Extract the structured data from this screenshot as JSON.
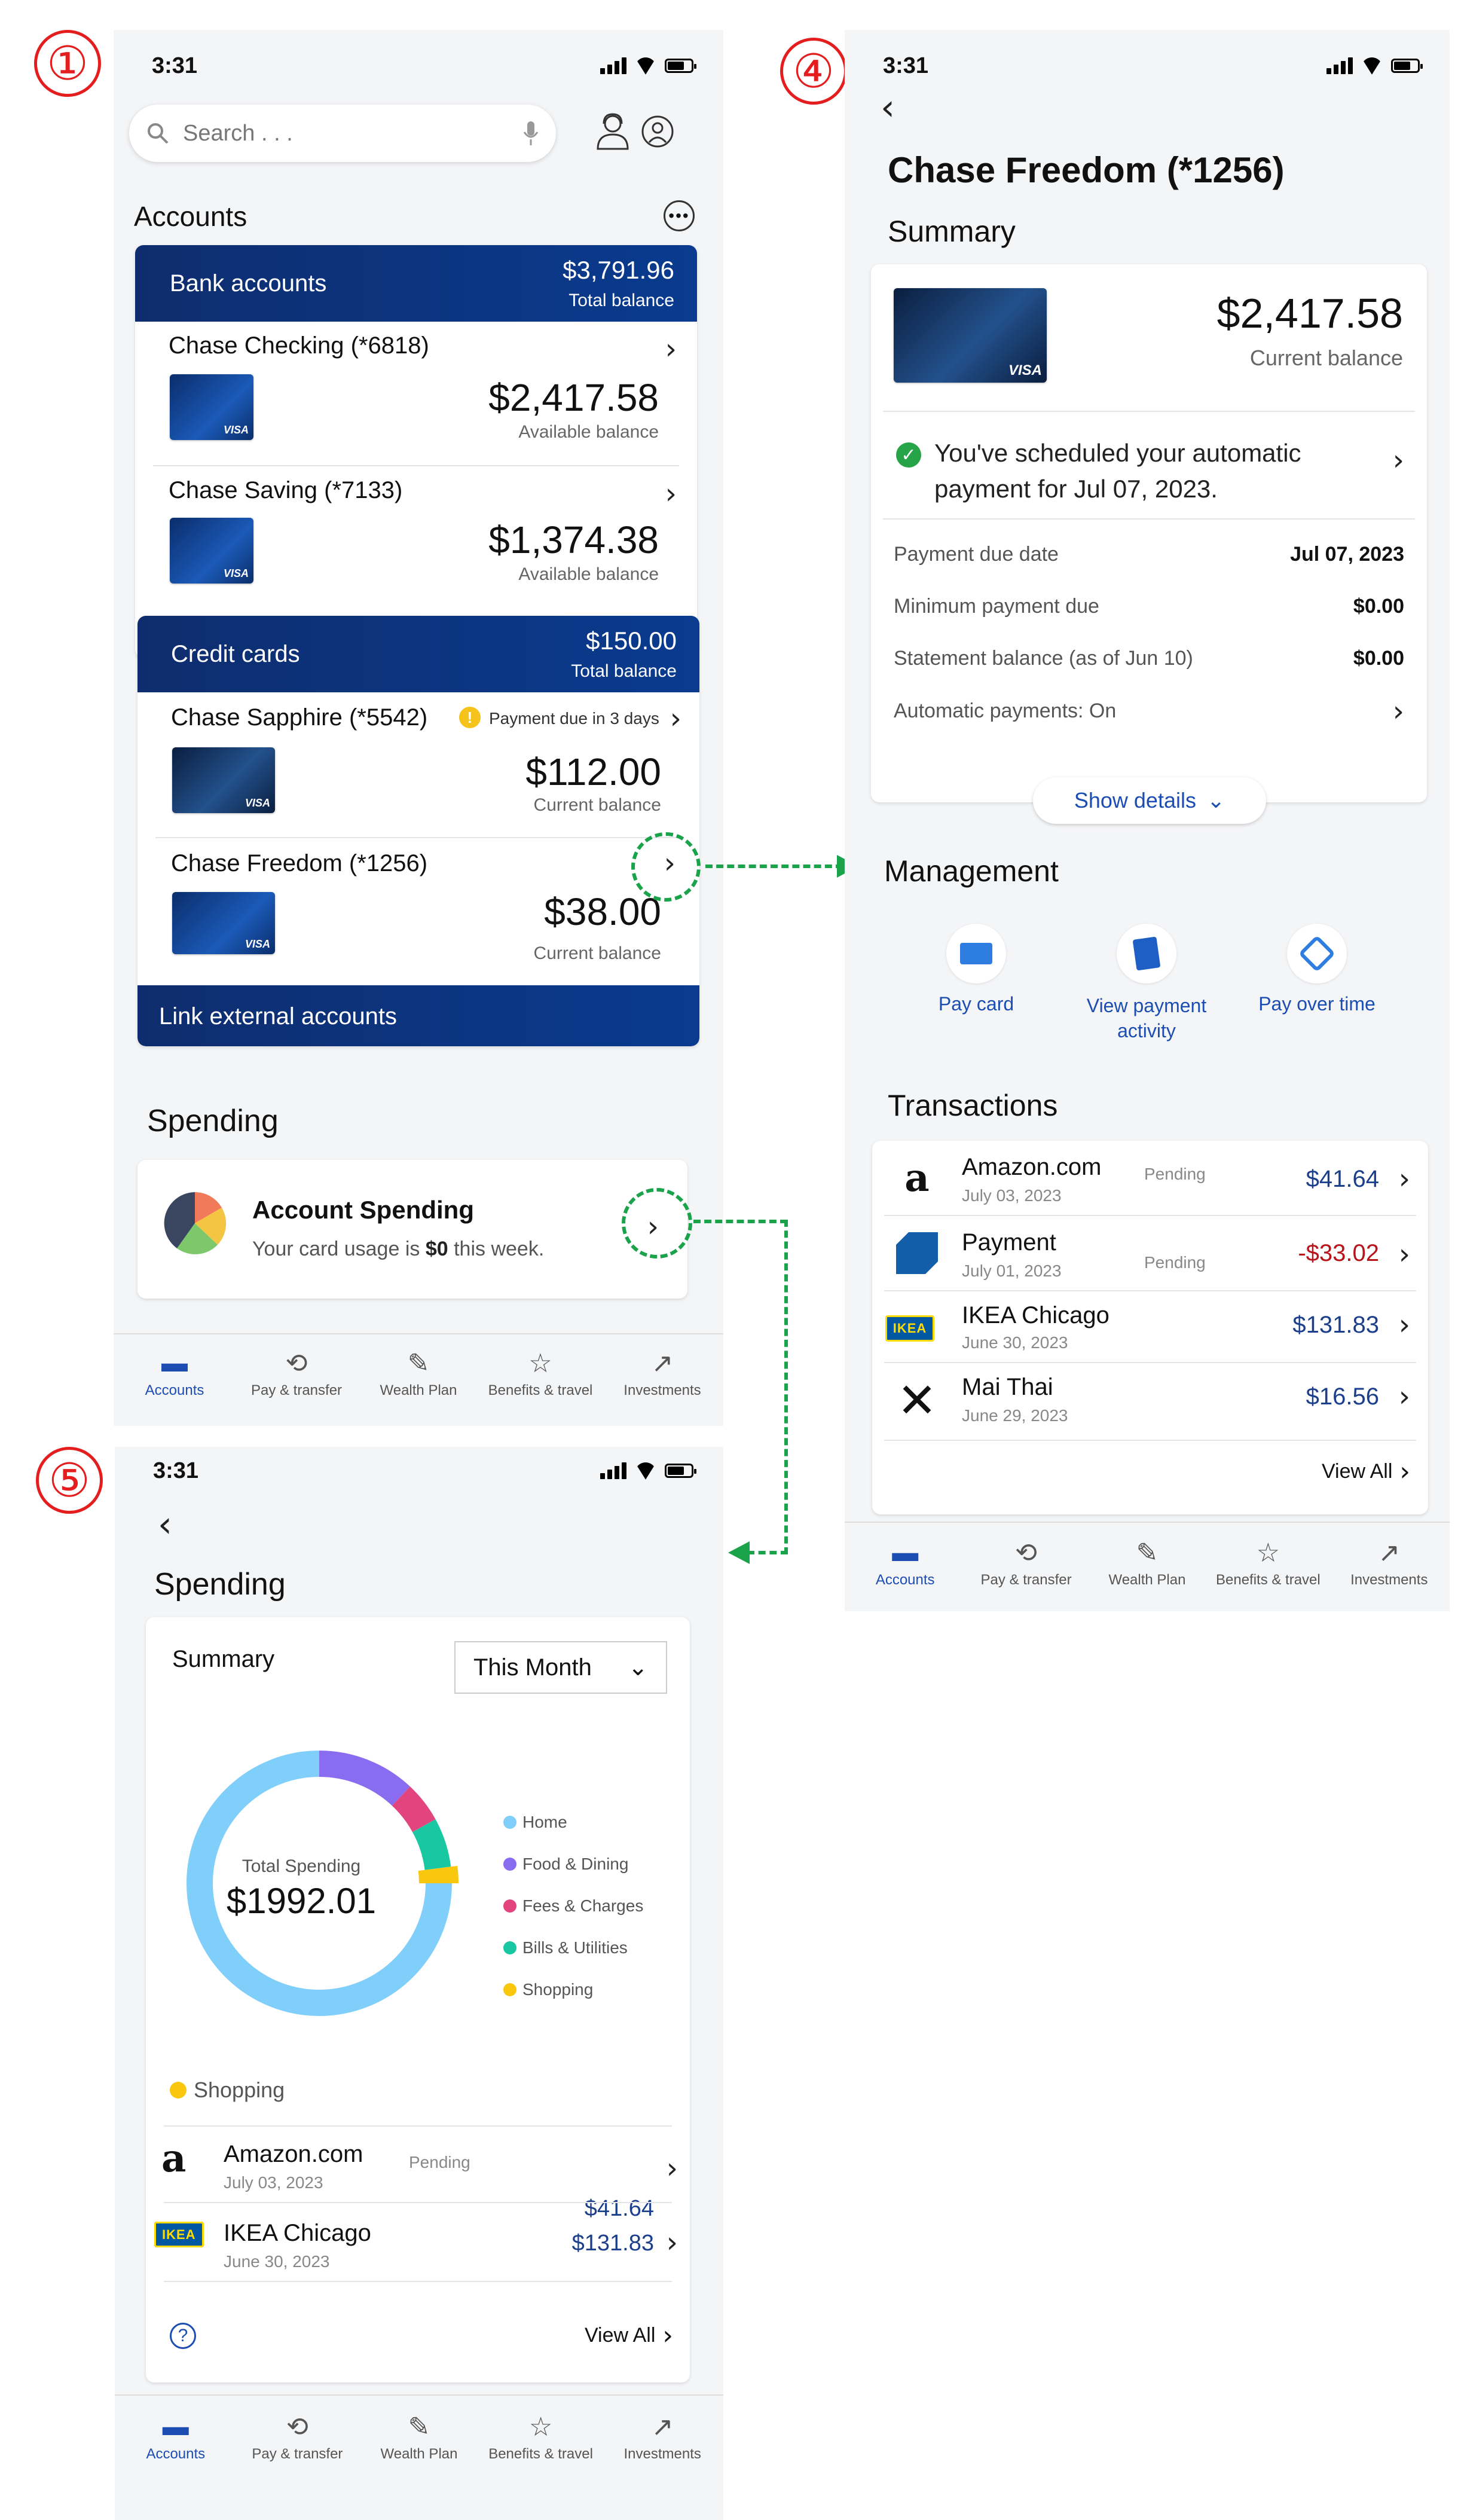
{
  "markers": [
    "①",
    "④",
    "⑤"
  ],
  "status": {
    "time": "3:31"
  },
  "screen1": {
    "search_placeholder": "Search . . .",
    "accounts_title": "Accounts",
    "bank": {
      "label": "Bank accounts",
      "total": "$3,791.96",
      "total_label": "Total balance"
    },
    "bank_items": [
      {
        "name": "Chase Checking (*6818)",
        "amount": "$2,417.58",
        "sub": "Available balance"
      },
      {
        "name": "Chase Saving (*7133)",
        "amount": "$1,374.38",
        "sub": "Available balance"
      }
    ],
    "credit": {
      "label": "Credit cards",
      "total": "$150.00",
      "total_label": "Total balance"
    },
    "credit_items": [
      {
        "name": "Chase Sapphire (*5542)",
        "alert": "Payment due in 3 days",
        "amount": "$112.00",
        "sub": "Current balance"
      },
      {
        "name": "Chase Freedom (*1256)",
        "amount": "$38.00",
        "sub": "Current balance"
      }
    ],
    "link_external": "Link external accounts",
    "spending_title": "Spending",
    "account_spending": {
      "title": "Account Spending",
      "text_pre": "Your card usage is ",
      "text_bold": "$0",
      "text_post": " this week."
    }
  },
  "tabs": [
    "Accounts",
    "Pay & transfer",
    "Wealth Plan",
    "Benefits & travel",
    "Investments"
  ],
  "screen4": {
    "title": "Chase Freedom (*1256)",
    "summary_title": "Summary",
    "balance": "$2,417.58",
    "balance_label": "Current balance",
    "scheduled": "You've scheduled your automatic payment for Jul 07, 2023.",
    "details": [
      {
        "label": "Payment due date",
        "value": "Jul 07, 2023"
      },
      {
        "label": "Minimum payment due",
        "value": "$0.00"
      },
      {
        "label": "Statement balance (as of Jun 10)",
        "value": "$0.00"
      },
      {
        "label": "Automatic payments: On",
        "value": ""
      }
    ],
    "show_details": "Show details",
    "management_title": "Management",
    "management": [
      {
        "label": "Pay card",
        "icon": "card-icon"
      },
      {
        "label": "View payment activity",
        "icon": "receipt-icon"
      },
      {
        "label": "Pay over time",
        "icon": "tag-icon"
      }
    ],
    "transactions_title": "Transactions",
    "transactions": [
      {
        "name": "Amazon.com",
        "date": "July 03, 2023",
        "status": "Pending",
        "amount": "$41.64",
        "logo": "amazon"
      },
      {
        "name": "Payment",
        "date": "July 01, 2023",
        "status": "Pending",
        "amount": "-$33.02",
        "logo": "chase"
      },
      {
        "name": "IKEA Chicago",
        "date": "June 30, 2023",
        "status": "",
        "amount": "$131.83",
        "logo": "ikea"
      },
      {
        "name": "Mai Thai",
        "date": "June 29, 2023",
        "status": "",
        "amount": "$16.56",
        "logo": "fork"
      }
    ],
    "view_all": "View All",
    "negative_color": "#b8141a"
  },
  "screen5": {
    "title": "Spending",
    "summary": "Summary",
    "period": "This Month",
    "total_label": "Total Spending",
    "total_value": "$1992.01",
    "chart_data": {
      "type": "pie",
      "categories": [
        "Home",
        "Food & Dining",
        "Fees & Charges",
        "Bills & Utilities",
        "Shopping"
      ],
      "values": [
        75,
        12,
        5,
        6,
        2
      ],
      "colors": [
        "#80cffb",
        "#8a6cf0",
        "#e2457e",
        "#19c7a3",
        "#f9c80e"
      ]
    },
    "shopping_label": "Shopping",
    "transactions": [
      {
        "name": "Amazon.com",
        "date": "July 03, 2023",
        "status": "Pending",
        "amount": "$41.64"
      },
      {
        "name": "IKEA Chicago",
        "date": "June 30, 2023",
        "amount": "$131.83"
      }
    ],
    "view_all": "View All"
  },
  "ikea_text": "IKEA"
}
